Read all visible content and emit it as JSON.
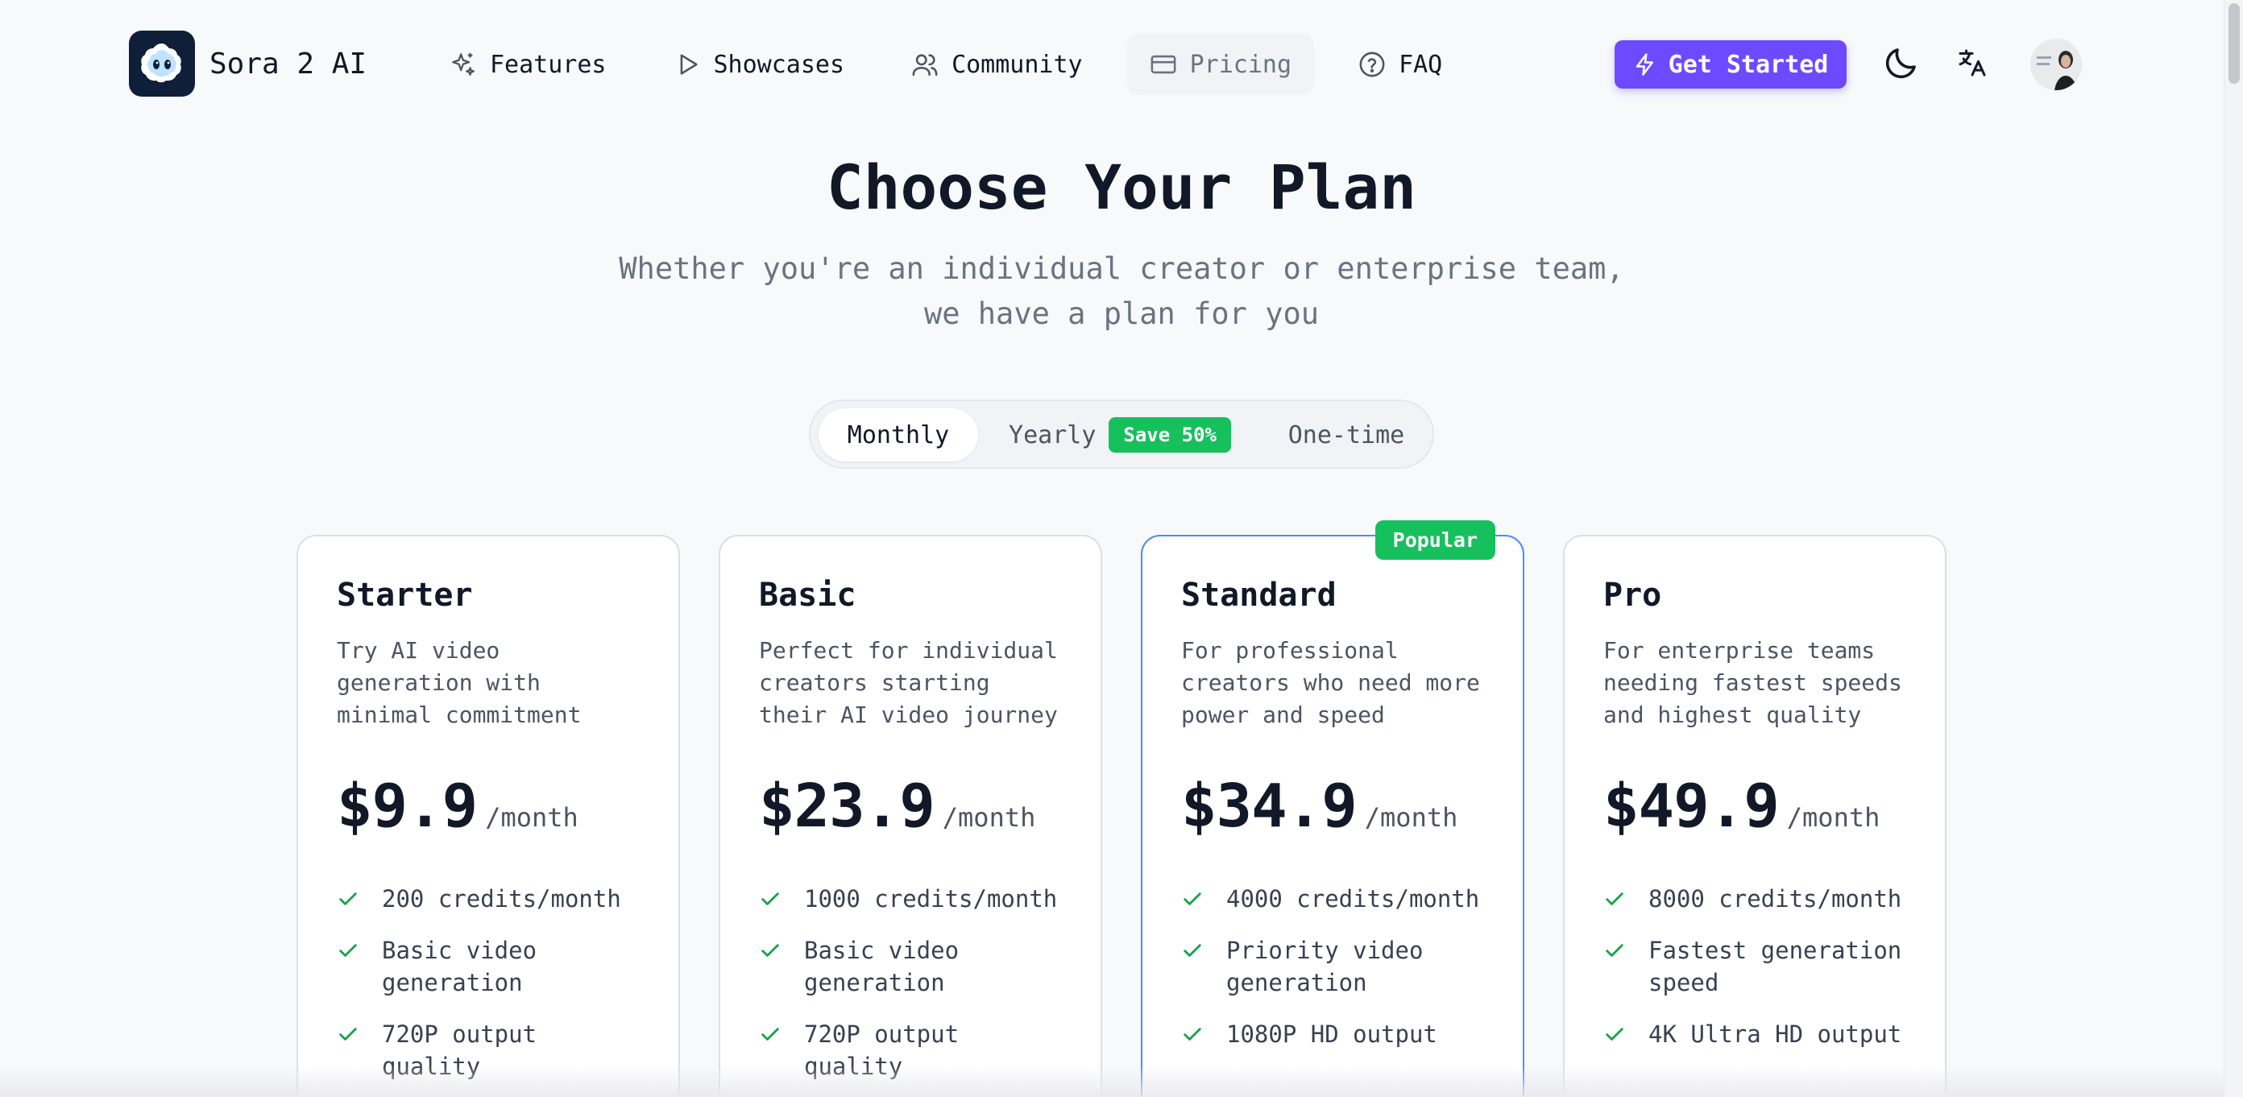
{
  "header": {
    "brand": "Sora 2 AI",
    "nav": [
      {
        "label": "Features",
        "icon": "sparkles-icon"
      },
      {
        "label": "Showcases",
        "icon": "play-icon"
      },
      {
        "label": "Community",
        "icon": "users-icon"
      },
      {
        "label": "Pricing",
        "icon": "credit-card-icon",
        "active": true
      },
      {
        "label": "FAQ",
        "icon": "help-circle-icon"
      }
    ],
    "cta_label": "Get Started",
    "accent_color": "#6d4aff"
  },
  "hero": {
    "title": "Choose Your Plan",
    "subtitle": "Whether you're an individual creator or enterprise team, we have a plan for you"
  },
  "billing_toggle": {
    "options": [
      "Monthly",
      "Yearly",
      "One-time"
    ],
    "selected": "Monthly",
    "yearly_badge": "Save 50%"
  },
  "plans": [
    {
      "name": "Starter",
      "description": "Try AI video generation with minimal commitment",
      "price": "$9.9",
      "period": "/month",
      "features": [
        "200 credits/month",
        "Basic video generation",
        "720P output quality"
      ]
    },
    {
      "name": "Basic",
      "description": "Perfect for individual creators starting their AI video journey",
      "price": "$23.9",
      "period": "/month",
      "features": [
        "1000 credits/month",
        "Basic video generation",
        "720P output quality"
      ]
    },
    {
      "name": "Standard",
      "description": "For professional creators who need more power and speed",
      "price": "$34.9",
      "period": "/month",
      "badge": "Popular",
      "features": [
        "4000 credits/month",
        "Priority video generation",
        "1080P HD output"
      ]
    },
    {
      "name": "Pro",
      "description": "For enterprise teams needing fastest speeds and highest quality",
      "price": "$49.9",
      "period": "/month",
      "features": [
        "8000 credits/month",
        "Fastest generation speed",
        "4K Ultra HD output"
      ]
    }
  ],
  "colors": {
    "check": "#16a34a",
    "popular_border": "#4c8df6",
    "badge_green": "#16c05d"
  }
}
